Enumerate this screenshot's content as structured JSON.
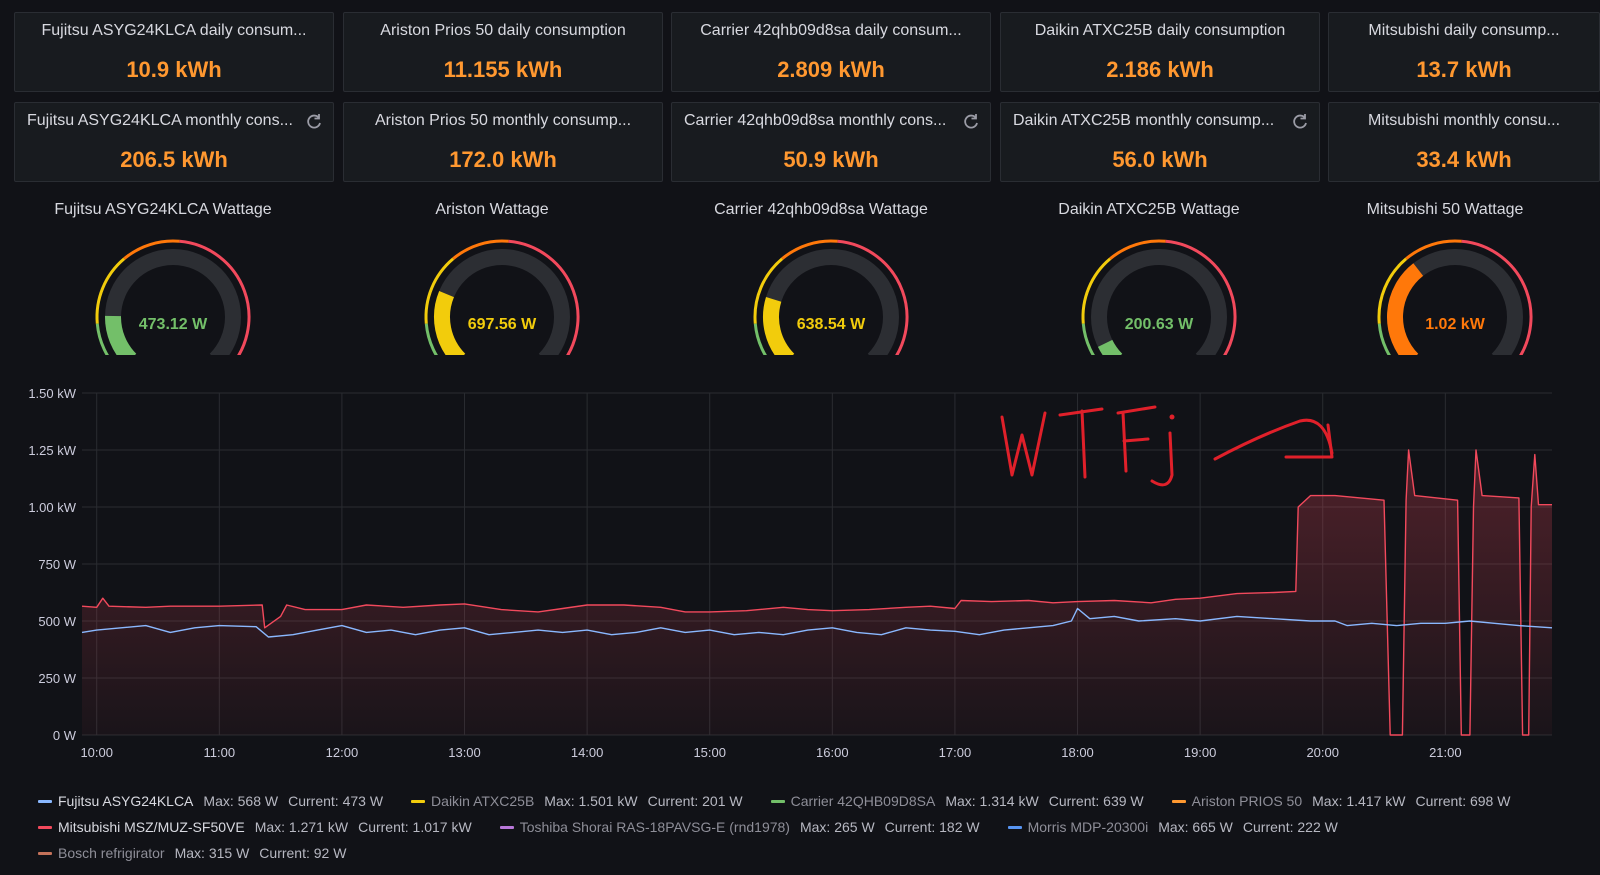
{
  "daily_stats": [
    {
      "title": "Fujitsu ASYG24KLCA daily consum...",
      "value": "10.9 kWh"
    },
    {
      "title": "Ariston Prios 50 daily consumption",
      "value": "11.155 kWh"
    },
    {
      "title": "Carrier 42qhb09d8sa daily consum...",
      "value": "2.809 kWh"
    },
    {
      "title": "Daikin ATXC25B daily consumption",
      "value": "2.186 kWh"
    },
    {
      "title": "Mitsubishi daily consump...",
      "value": "13.7 kWh"
    }
  ],
  "monthly_stats": [
    {
      "title": "Fujitsu ASYG24KLCA monthly cons...",
      "value": "206.5 kWh",
      "refresh_icon": "refresh-icon"
    },
    {
      "title": "Ariston Prios 50 monthly consump...",
      "value": "172.0 kWh"
    },
    {
      "title": "Carrier 42qhb09d8sa monthly cons...",
      "value": "50.9 kWh",
      "refresh_icon": "refresh-icon"
    },
    {
      "title": "Daikin ATXC25B monthly consump...",
      "value": "56.0 kWh",
      "refresh_icon": "refresh-icon"
    },
    {
      "title": "Mitsubishi monthly consu...",
      "value": "33.4 kWh"
    }
  ],
  "gauges": [
    {
      "title": "Fujitsu ASYG24KLCA Wattage",
      "value": "473.12 W",
      "fraction": 0.17,
      "color": "#73bf69"
    },
    {
      "title": "Ariston Wattage",
      "value": "697.56 W",
      "fraction": 0.25,
      "color": "#f2cc0c"
    },
    {
      "title": "Carrier 42qhb09d8sa Wattage",
      "value": "638.54 W",
      "fraction": 0.23,
      "color": "#f2cc0c"
    },
    {
      "title": "Daikin ATXC25B Wattage",
      "value": "200.63 W",
      "fraction": 0.07,
      "color": "#73bf69"
    },
    {
      "title": "Mitsubishi 50 Wattage",
      "value": "1.02 kW",
      "fraction": 0.36,
      "color": "#ff780a"
    }
  ],
  "chart_data": {
    "type": "line",
    "x_ticks": [
      "10:00",
      "11:00",
      "12:00",
      "13:00",
      "14:00",
      "15:00",
      "16:00",
      "17:00",
      "18:00",
      "19:00",
      "20:00",
      "21:00"
    ],
    "y_ticks": [
      "0 W",
      "250 W",
      "500 W",
      "750 W",
      "1.00 kW",
      "1.25 kW",
      "1.50 kW"
    ],
    "xlim_hours": [
      9.88,
      21.87
    ],
    "ylim_w": [
      0,
      1500
    ],
    "grid": true,
    "series": [
      {
        "name": "Mitsubishi MSZ/MUZ-SF50VE",
        "color": "#f2495c",
        "points": [
          [
            9.88,
            565
          ],
          [
            10.0,
            560
          ],
          [
            10.05,
            600
          ],
          [
            10.1,
            565
          ],
          [
            10.4,
            560
          ],
          [
            10.6,
            565
          ],
          [
            11.0,
            565
          ],
          [
            11.35,
            570
          ],
          [
            11.37,
            470
          ],
          [
            11.5,
            520
          ],
          [
            11.55,
            570
          ],
          [
            11.7,
            550
          ],
          [
            12.0,
            550
          ],
          [
            12.2,
            570
          ],
          [
            12.5,
            560
          ],
          [
            12.8,
            570
          ],
          [
            13.0,
            575
          ],
          [
            13.3,
            550
          ],
          [
            13.6,
            540
          ],
          [
            13.8,
            555
          ],
          [
            14.0,
            570
          ],
          [
            14.3,
            570
          ],
          [
            14.6,
            560
          ],
          [
            14.8,
            540
          ],
          [
            15.0,
            540
          ],
          [
            15.3,
            545
          ],
          [
            15.6,
            560
          ],
          [
            15.8,
            550
          ],
          [
            16.0,
            545
          ],
          [
            16.3,
            550
          ],
          [
            16.6,
            560
          ],
          [
            16.8,
            565
          ],
          [
            17.0,
            555
          ],
          [
            17.05,
            590
          ],
          [
            17.3,
            585
          ],
          [
            17.6,
            590
          ],
          [
            17.8,
            580
          ],
          [
            18.0,
            585
          ],
          [
            18.3,
            590
          ],
          [
            18.6,
            580
          ],
          [
            18.8,
            595
          ],
          [
            19.0,
            600
          ],
          [
            19.3,
            620
          ],
          [
            19.6,
            625
          ],
          [
            19.78,
            630
          ],
          [
            19.8,
            1000
          ],
          [
            19.9,
            1050
          ],
          [
            20.1,
            1050
          ],
          [
            20.5,
            1030
          ],
          [
            20.55,
            0
          ],
          [
            20.65,
            0
          ],
          [
            20.68,
            1030
          ],
          [
            20.7,
            1250
          ],
          [
            20.75,
            1050
          ],
          [
            21.1,
            1030
          ],
          [
            21.13,
            0
          ],
          [
            21.2,
            0
          ],
          [
            21.23,
            1000
          ],
          [
            21.25,
            1250
          ],
          [
            21.3,
            1050
          ],
          [
            21.6,
            1040
          ],
          [
            21.63,
            0
          ],
          [
            21.68,
            0
          ],
          [
            21.7,
            1000
          ],
          [
            21.73,
            1230
          ],
          [
            21.76,
            1010
          ],
          [
            21.87,
            1010
          ]
        ],
        "fill": true
      },
      {
        "name": "Fujitsu ASYG24KLCA",
        "color": "#8ab8ff",
        "points": [
          [
            9.88,
            450
          ],
          [
            10.0,
            460
          ],
          [
            10.2,
            470
          ],
          [
            10.4,
            480
          ],
          [
            10.6,
            450
          ],
          [
            10.8,
            470
          ],
          [
            11.0,
            480
          ],
          [
            11.3,
            475
          ],
          [
            11.4,
            430
          ],
          [
            11.6,
            440
          ],
          [
            11.8,
            460
          ],
          [
            12.0,
            480
          ],
          [
            12.2,
            450
          ],
          [
            12.4,
            460
          ],
          [
            12.6,
            440
          ],
          [
            12.8,
            460
          ],
          [
            13.0,
            470
          ],
          [
            13.2,
            440
          ],
          [
            13.4,
            450
          ],
          [
            13.6,
            460
          ],
          [
            13.8,
            450
          ],
          [
            14.0,
            460
          ],
          [
            14.2,
            440
          ],
          [
            14.4,
            450
          ],
          [
            14.6,
            470
          ],
          [
            14.8,
            450
          ],
          [
            15.0,
            460
          ],
          [
            15.2,
            440
          ],
          [
            15.4,
            450
          ],
          [
            15.6,
            440
          ],
          [
            15.8,
            460
          ],
          [
            16.0,
            470
          ],
          [
            16.2,
            450
          ],
          [
            16.4,
            440
          ],
          [
            16.6,
            470
          ],
          [
            16.8,
            460
          ],
          [
            17.0,
            455
          ],
          [
            17.2,
            440
          ],
          [
            17.4,
            460
          ],
          [
            17.6,
            470
          ],
          [
            17.8,
            480
          ],
          [
            17.95,
            500
          ],
          [
            18.0,
            555
          ],
          [
            18.1,
            510
          ],
          [
            18.3,
            520
          ],
          [
            18.5,
            500
          ],
          [
            18.8,
            510
          ],
          [
            19.0,
            500
          ],
          [
            19.3,
            520
          ],
          [
            19.6,
            510
          ],
          [
            19.9,
            500
          ],
          [
            20.1,
            500
          ],
          [
            20.2,
            480
          ],
          [
            20.4,
            490
          ],
          [
            20.6,
            480
          ],
          [
            20.8,
            490
          ],
          [
            21.0,
            490
          ],
          [
            21.2,
            500
          ],
          [
            21.4,
            490
          ],
          [
            21.6,
            480
          ],
          [
            21.87,
            470
          ]
        ],
        "fill": false
      }
    ],
    "legend": [
      [
        {
          "name": "Fujitsu ASYG24KLCA",
          "max": "Max: 568 W",
          "current": "Current: 473 W",
          "color": "#8ab8ff"
        },
        {
          "name": "Daikin ATXC25B",
          "max": "Max: 1.501 kW",
          "current": "Current: 201 W",
          "color": "#f2cc0c"
        },
        {
          "name": "Carrier 42QHB09D8SA",
          "max": "Max: 1.314 kW",
          "current": "Current: 639 W",
          "color": "#73bf69"
        },
        {
          "name": "Ariston PRIOS 50",
          "max": "Max: 1.417 kW",
          "current": "Current: 698 W",
          "color": "#ff9830"
        }
      ],
      [
        {
          "name": "Mitsubishi MSZ/MUZ-SF50VE",
          "max": "Max: 1.271 kW",
          "current": "Current: 1.017 kW",
          "color": "#f2495c"
        },
        {
          "name": "Toshiba Shorai RAS-18PAVSG-E (rnd1978)",
          "max": "Max: 265 W",
          "current": "Current: 182 W",
          "color": "#b877d9"
        },
        {
          "name": "Morris MDP-20300i",
          "max": "Max: 665 W",
          "current": "Current: 222 W",
          "color": "#5794f2"
        }
      ],
      [
        {
          "name": "Bosch refrigirator",
          "max": "Max: 315 W",
          "current": "Current: 92 W",
          "color": "#c4725a"
        }
      ]
    ]
  },
  "annotation": {
    "text": "WTFj",
    "color": "#e0202a"
  }
}
